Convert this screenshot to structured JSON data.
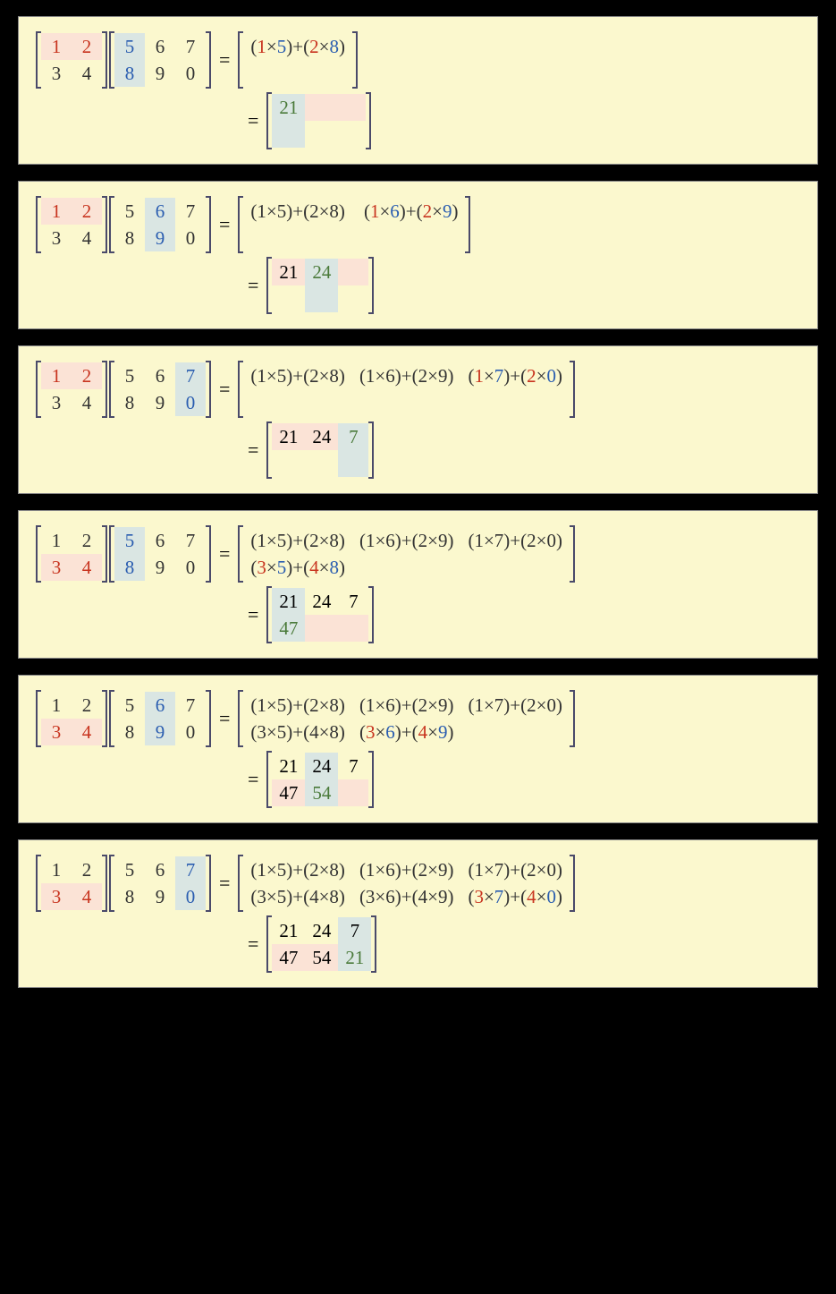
{
  "matrixA": [
    [
      "1",
      "2"
    ],
    [
      "3",
      "4"
    ]
  ],
  "matrixB": [
    [
      "5",
      "6",
      "7"
    ],
    [
      "8",
      "9",
      "0"
    ]
  ],
  "result": [
    [
      "21",
      "24",
      "7"
    ],
    [
      "47",
      "54",
      "21"
    ]
  ],
  "steps": [
    {
      "rowA_hl": 0,
      "colB_hl": 0,
      "expr": [
        [
          {
            "t": "(1×5)+(2×8)",
            "new": true
          }
        ]
      ],
      "expr_wide": true,
      "res_rows": 2,
      "res_cols": 3,
      "res_fill": [
        [
          0,
          0
        ]
      ],
      "new_cell": [
        0,
        0
      ]
    },
    {
      "rowA_hl": 0,
      "colB_hl": 1,
      "expr": [
        [
          {
            "t": "(1×5)+(2×8)"
          },
          {
            "t": "(1×6)+(2×9)",
            "new": true
          }
        ]
      ],
      "expr_wide": true,
      "res_rows": 2,
      "res_cols": 3,
      "res_fill": [
        [
          0,
          0
        ],
        [
          0,
          1
        ]
      ],
      "new_cell": [
        0,
        1
      ]
    },
    {
      "rowA_hl": 0,
      "colB_hl": 2,
      "expr": [
        [
          {
            "t": "(1×5)+(2×8)"
          },
          {
            "t": "(1×6)+(2×9)"
          },
          {
            "t": "(1×7)+(2×0)",
            "new": true
          }
        ]
      ],
      "res_rows": 2,
      "res_cols": 3,
      "res_fill": [
        [
          0,
          0
        ],
        [
          0,
          1
        ],
        [
          0,
          2
        ]
      ],
      "new_cell": [
        0,
        2
      ]
    },
    {
      "rowA_hl": 1,
      "colB_hl": 0,
      "expr": [
        [
          {
            "t": "(1×5)+(2×8)"
          },
          {
            "t": "(1×6)+(2×9)"
          },
          {
            "t": "(1×7)+(2×0)"
          }
        ],
        [
          {
            "t": "(3×5)+(4×8)",
            "new": true
          }
        ]
      ],
      "res_rows": 2,
      "res_cols": 3,
      "res_fill": [
        [
          0,
          0
        ],
        [
          0,
          1
        ],
        [
          0,
          2
        ],
        [
          1,
          0
        ]
      ],
      "new_cell": [
        1,
        0
      ]
    },
    {
      "rowA_hl": 1,
      "colB_hl": 1,
      "expr": [
        [
          {
            "t": "(1×5)+(2×8)"
          },
          {
            "t": "(1×6)+(2×9)"
          },
          {
            "t": "(1×7)+(2×0)"
          }
        ],
        [
          {
            "t": "(3×5)+(4×8)"
          },
          {
            "t": "(3×6)+(4×9)",
            "new": true
          }
        ]
      ],
      "res_rows": 2,
      "res_cols": 3,
      "res_fill": [
        [
          0,
          0
        ],
        [
          0,
          1
        ],
        [
          0,
          2
        ],
        [
          1,
          0
        ],
        [
          1,
          1
        ]
      ],
      "new_cell": [
        1,
        1
      ]
    },
    {
      "rowA_hl": 1,
      "colB_hl": 2,
      "expr": [
        [
          {
            "t": "(1×5)+(2×8)"
          },
          {
            "t": "(1×6)+(2×9)"
          },
          {
            "t": "(1×7)+(2×0)"
          }
        ],
        [
          {
            "t": "(3×5)+(4×8)"
          },
          {
            "t": "(3×6)+(4×9)"
          },
          {
            "t": "(3×7)+(4×0)",
            "new": true
          }
        ]
      ],
      "res_rows": 2,
      "res_cols": 3,
      "res_fill": [
        [
          0,
          0
        ],
        [
          0,
          1
        ],
        [
          0,
          2
        ],
        [
          1,
          0
        ],
        [
          1,
          1
        ],
        [
          1,
          2
        ]
      ],
      "new_cell": [
        1,
        2
      ]
    }
  ],
  "colors": {
    "rowA": [
      "#c8341f",
      "#c8341f"
    ],
    "colB": [
      "#2a5db0",
      "#2a5db0"
    ]
  }
}
